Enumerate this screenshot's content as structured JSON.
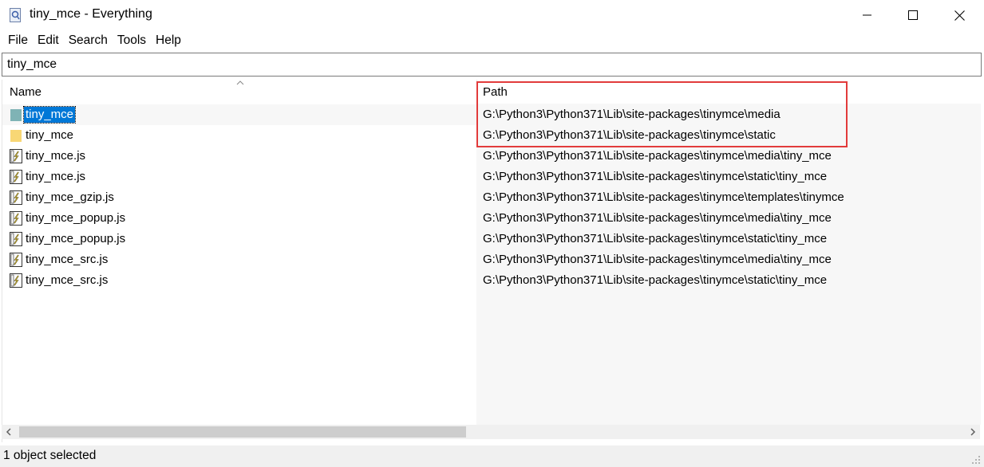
{
  "window": {
    "title": "tiny_mce - Everything",
    "icon": "everything-app-icon"
  },
  "controls": {
    "minimize_icon": "minimize-icon",
    "maximize_icon": "maximize-icon",
    "close_icon": "close-icon"
  },
  "menu": {
    "items": [
      {
        "label": "File"
      },
      {
        "label": "Edit"
      },
      {
        "label": "Search"
      },
      {
        "label": "Tools"
      },
      {
        "label": "Help"
      }
    ]
  },
  "search": {
    "value": "tiny_mce"
  },
  "columns": {
    "name": "Name",
    "path": "Path",
    "sort_indicator": "sort-ascending-icon"
  },
  "rows": [
    {
      "name": "tiny_mce",
      "path": "G:\\Python3\\Python371\\Lib\\site-packages\\tinymce\\media",
      "icon": "folder-icon",
      "selected": true
    },
    {
      "name": "tiny_mce",
      "path": "G:\\Python3\\Python371\\Lib\\site-packages\\tinymce\\static",
      "icon": "folder-icon",
      "selected": false
    },
    {
      "name": "tiny_mce.js",
      "path": "G:\\Python3\\Python371\\Lib\\site-packages\\tinymce\\media\\tiny_mce",
      "icon": "script-file-icon",
      "selected": false
    },
    {
      "name": "tiny_mce.js",
      "path": "G:\\Python3\\Python371\\Lib\\site-packages\\tinymce\\static\\tiny_mce",
      "icon": "script-file-icon",
      "selected": false
    },
    {
      "name": "tiny_mce_gzip.js",
      "path": "G:\\Python3\\Python371\\Lib\\site-packages\\tinymce\\templates\\tinymce",
      "icon": "script-file-icon",
      "selected": false
    },
    {
      "name": "tiny_mce_popup.js",
      "path": "G:\\Python3\\Python371\\Lib\\site-packages\\tinymce\\media\\tiny_mce",
      "icon": "script-file-icon",
      "selected": false
    },
    {
      "name": "tiny_mce_popup.js",
      "path": "G:\\Python3\\Python371\\Lib\\site-packages\\tinymce\\static\\tiny_mce",
      "icon": "script-file-icon",
      "selected": false
    },
    {
      "name": "tiny_mce_src.js",
      "path": "G:\\Python3\\Python371\\Lib\\site-packages\\tinymce\\media\\tiny_mce",
      "icon": "script-file-icon",
      "selected": false
    },
    {
      "name": "tiny_mce_src.js",
      "path": "G:\\Python3\\Python371\\Lib\\site-packages\\tinymce\\static\\tiny_mce",
      "icon": "script-file-icon",
      "selected": false
    }
  ],
  "status": {
    "text": "1 object selected"
  },
  "colors": {
    "selection": "#0078d7",
    "highlight_box": "#e23b3b",
    "folder": "#f8d775",
    "selected_folder": "#7fb3b5"
  }
}
